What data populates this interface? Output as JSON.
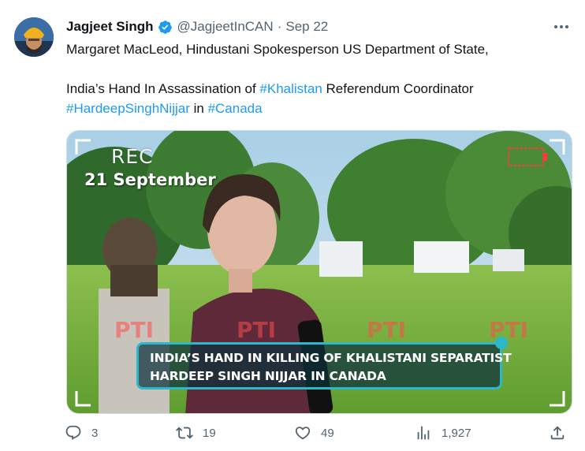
{
  "tweet": {
    "author": {
      "display_name": "Jagjeet Singh",
      "handle": "@JagjeetInCAN",
      "separator": "·",
      "time": "Sep 22",
      "verified": true,
      "avatar_icon": "avatar-turban"
    },
    "text": {
      "line1": "Margaret MacLeod, Hindustani Spokesperson US Department of State,",
      "line2_pre": "India’s Hand In Assassination of ",
      "line2_tag": "#Khalistan",
      "line2_post": " Referendum Coordinator",
      "line3_tag1": "#HardeepSinghNijjar",
      "line3_mid": " in ",
      "line3_tag2": "#Canada"
    },
    "media": {
      "rec_label": "REC",
      "date_label": "21 September",
      "caption_line1": "INDIA’S HAND IN KILLING OF KHALISTANI SEPARATIST",
      "caption_line2": "HARDEEP SINGH NIJJAR IN CANADA",
      "watermark": "PTI"
    },
    "actions": {
      "replies": "3",
      "retweets": "19",
      "likes": "49",
      "views": "1,927"
    },
    "colors": {
      "link": "#1d9bf0",
      "muted": "#536471",
      "verified": "#1d9bf0",
      "caption_border": "#2db8c9"
    }
  }
}
